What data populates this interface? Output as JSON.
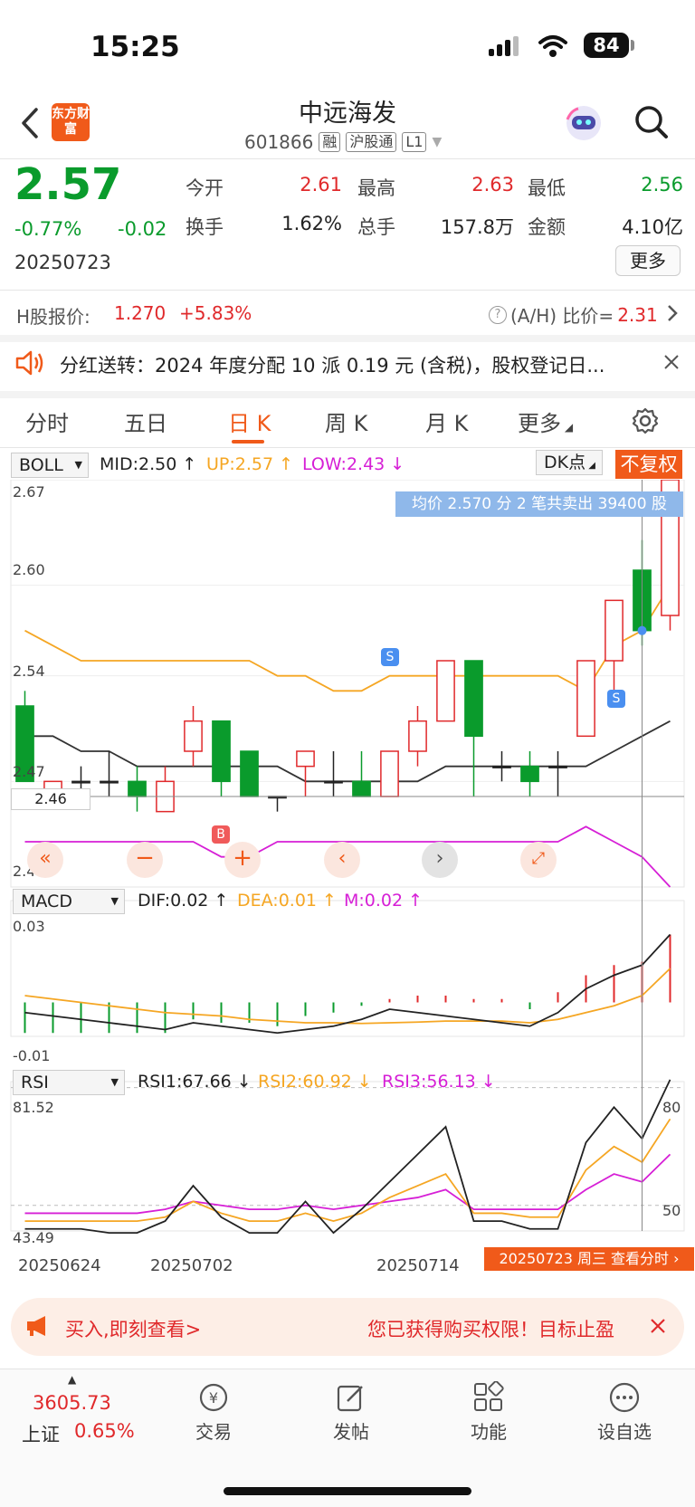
{
  "status_bar": {
    "time": "15:25",
    "battery": "84"
  },
  "header": {
    "logo_text": "东方财富",
    "stock_name": "中远海发",
    "stock_code": "601866",
    "tags": [
      "融",
      "沪股通",
      "L1"
    ]
  },
  "quote": {
    "price": "2.57",
    "change_pct": "-0.77%",
    "change": "-0.02",
    "date": "20250723",
    "open_label": "今开",
    "open": "2.61",
    "high_label": "最高",
    "high": "2.63",
    "low_label": "最低",
    "low": "2.56",
    "turnover_label": "换手",
    "turnover": "1.62%",
    "volume_label": "总手",
    "volume": "157.8万",
    "amount_label": "金额",
    "amount": "4.10亿",
    "more_label": "更多"
  },
  "h_share": {
    "label": "H股报价:",
    "price": "1.270",
    "change": "+5.83%",
    "ah_label": "(A/H) 比价=",
    "ah_value": "2.31"
  },
  "notice": {
    "text": "分红送转：2024 年度分配 10 派 0.19 元 (含税)，股权登记日..."
  },
  "tabs": [
    "分时",
    "五日",
    "日 K",
    "周 K",
    "月 K",
    "更多"
  ],
  "active_tab": "日 K",
  "boll": {
    "select": "BOLL",
    "mid": "MID:2.50",
    "up": "UP:2.57",
    "low": "LOW:2.43",
    "dk_label": "DK点",
    "fq_label": "不复权",
    "banner": "均价 2.570 分 2 笔共卖出 39400 股",
    "y_labels": [
      "2.67",
      "2.60",
      "2.54",
      "2.47",
      "2.46",
      "2.40"
    ],
    "marker_s": "S",
    "marker_b": "B"
  },
  "macd": {
    "select": "MACD",
    "dif": "DIF:0.02",
    "dea": "DEA:0.01",
    "m": "M:0.02",
    "y_top": "0.03",
    "y_bottom": "-0.01"
  },
  "rsi": {
    "select": "RSI",
    "rsi1": "RSI1:67.66",
    "rsi2": "RSI2:60.92",
    "rsi3": "RSI3:56.13",
    "y_top": "81.52",
    "y_bottom": "43.49",
    "right_80": "80",
    "right_50": "50"
  },
  "x_dates": [
    "20250624",
    "20250702",
    "20250714"
  ],
  "date_badge": "20250723 周三 查看分时",
  "ad": {
    "left_text": "买入,即刻查看>",
    "right_text": "您已获得购买权限！目标止盈"
  },
  "bottom_nav": {
    "index_value": "3605.73",
    "index_name": "上证",
    "index_change": "0.65%",
    "items": [
      "交易",
      "发帖",
      "功能",
      "设自选"
    ]
  },
  "colors": {
    "up": "#e0292b",
    "down": "#0a9b2c",
    "accent": "#f05a1a",
    "upper_band": "#f5a623",
    "lower_band": "#d61fd6"
  },
  "chart_data": {
    "type": "candlestick",
    "dates_visible": [
      "20250624",
      "20250702",
      "20250714",
      "20250723"
    ],
    "candles": [
      {
        "o": 2.52,
        "h": 2.53,
        "l": 2.47,
        "c": 2.47
      },
      {
        "o": 2.46,
        "h": 2.47,
        "l": 2.46,
        "c": 2.47
      },
      {
        "o": 2.47,
        "h": 2.48,
        "l": 2.46,
        "c": 2.47
      },
      {
        "o": 2.47,
        "h": 2.49,
        "l": 2.46,
        "c": 2.47
      },
      {
        "o": 2.47,
        "h": 2.48,
        "l": 2.45,
        "c": 2.46
      },
      {
        "o": 2.45,
        "h": 2.48,
        "l": 2.45,
        "c": 2.47
      },
      {
        "o": 2.49,
        "h": 2.52,
        "l": 2.48,
        "c": 2.51
      },
      {
        "o": 2.51,
        "h": 2.51,
        "l": 2.46,
        "c": 2.47
      },
      {
        "o": 2.49,
        "h": 2.49,
        "l": 2.46,
        "c": 2.46
      },
      {
        "o": 2.46,
        "h": 2.46,
        "l": 2.45,
        "c": 2.46
      },
      {
        "o": 2.48,
        "h": 2.49,
        "l": 2.46,
        "c": 2.49
      },
      {
        "o": 2.47,
        "h": 2.49,
        "l": 2.46,
        "c": 2.47
      },
      {
        "o": 2.47,
        "h": 2.49,
        "l": 2.46,
        "c": 2.46
      },
      {
        "o": 2.46,
        "h": 2.49,
        "l": 2.46,
        "c": 2.49
      },
      {
        "o": 2.49,
        "h": 2.52,
        "l": 2.48,
        "c": 2.51
      },
      {
        "o": 2.51,
        "h": 2.55,
        "l": 2.51,
        "c": 2.55
      },
      {
        "o": 2.55,
        "h": 2.55,
        "l": 2.46,
        "c": 2.5
      },
      {
        "o": 2.48,
        "h": 2.49,
        "l": 2.47,
        "c": 2.48
      },
      {
        "o": 2.48,
        "h": 2.49,
        "l": 2.46,
        "c": 2.47
      },
      {
        "o": 2.48,
        "h": 2.49,
        "l": 2.46,
        "c": 2.48
      },
      {
        "o": 2.5,
        "h": 2.55,
        "l": 2.5,
        "c": 2.55
      },
      {
        "o": 2.55,
        "h": 2.59,
        "l": 2.52,
        "c": 2.59
      },
      {
        "o": 2.61,
        "h": 2.63,
        "l": 2.56,
        "c": 2.57
      },
      {
        "o": 2.58,
        "h": 2.67,
        "l": 2.57,
        "c": 2.67
      }
    ],
    "mid": [
      2.5,
      2.5,
      2.49,
      2.49,
      2.48,
      2.48,
      2.48,
      2.48,
      2.48,
      2.48,
      2.47,
      2.47,
      2.47,
      2.47,
      2.47,
      2.48,
      2.48,
      2.48,
      2.48,
      2.48,
      2.48,
      2.49,
      2.5,
      2.51
    ],
    "up": [
      2.57,
      2.56,
      2.55,
      2.55,
      2.55,
      2.55,
      2.55,
      2.55,
      2.55,
      2.54,
      2.54,
      2.53,
      2.53,
      2.54,
      2.54,
      2.54,
      2.54,
      2.54,
      2.54,
      2.54,
      2.53,
      2.56,
      2.57,
      2.6
    ],
    "low": [
      2.43,
      2.43,
      2.43,
      2.43,
      2.43,
      2.43,
      2.43,
      2.42,
      2.42,
      2.43,
      2.43,
      2.43,
      2.43,
      2.43,
      2.43,
      2.43,
      2.43,
      2.43,
      2.43,
      2.43,
      2.44,
      2.43,
      2.42,
      2.4
    ],
    "ylim": [
      2.4,
      2.67
    ],
    "macd_dif": [
      -0.003,
      -0.004,
      -0.005,
      -0.006,
      -0.007,
      -0.008,
      -0.006,
      -0.007,
      -0.008,
      -0.009,
      -0.008,
      -0.007,
      -0.005,
      -0.002,
      -0.003,
      -0.004,
      -0.005,
      -0.006,
      -0.007,
      -0.003,
      0.004,
      0.008,
      0.011,
      0.02
    ],
    "macd_dea": [
      0.002,
      0.001,
      0.0,
      -0.001,
      -0.002,
      -0.003,
      -0.0035,
      -0.004,
      -0.005,
      -0.0055,
      -0.006,
      -0.006,
      -0.0062,
      -0.006,
      -0.0058,
      -0.0055,
      -0.0055,
      -0.0055,
      -0.006,
      -0.005,
      -0.003,
      -0.001,
      0.002,
      0.01
    ],
    "macd_hist": [
      -0.009,
      -0.009,
      -0.009,
      -0.009,
      -0.009,
      -0.009,
      -0.005,
      -0.006,
      -0.006,
      -0.007,
      -0.004,
      -0.003,
      -0.001,
      0.001,
      0.002,
      0.002,
      0.001,
      0.001,
      -0.002,
      0.003,
      0.008,
      0.011,
      0.012,
      0.02
    ],
    "macd_ylim": [
      -0.01,
      0.03
    ],
    "rsi1": [
      44,
      44,
      44,
      43,
      43,
      46,
      55,
      47,
      43,
      43,
      51,
      43,
      49,
      56,
      63,
      70,
      46,
      46,
      44,
      44,
      66,
      75,
      67,
      82
    ],
    "rsi2": [
      46,
      46,
      46,
      46,
      46,
      47,
      51,
      48,
      46,
      46,
      48,
      46,
      48,
      52,
      55,
      58,
      48,
      48,
      47,
      47,
      59,
      65,
      61,
      72
    ],
    "rsi3": [
      48,
      48,
      48,
      48,
      48,
      49,
      51,
      50,
      49,
      49,
      50,
      49,
      50,
      51,
      52,
      54,
      49,
      49,
      49,
      49,
      54,
      58,
      56,
      63
    ],
    "rsi_ylim": [
      43.49,
      81.52
    ]
  }
}
